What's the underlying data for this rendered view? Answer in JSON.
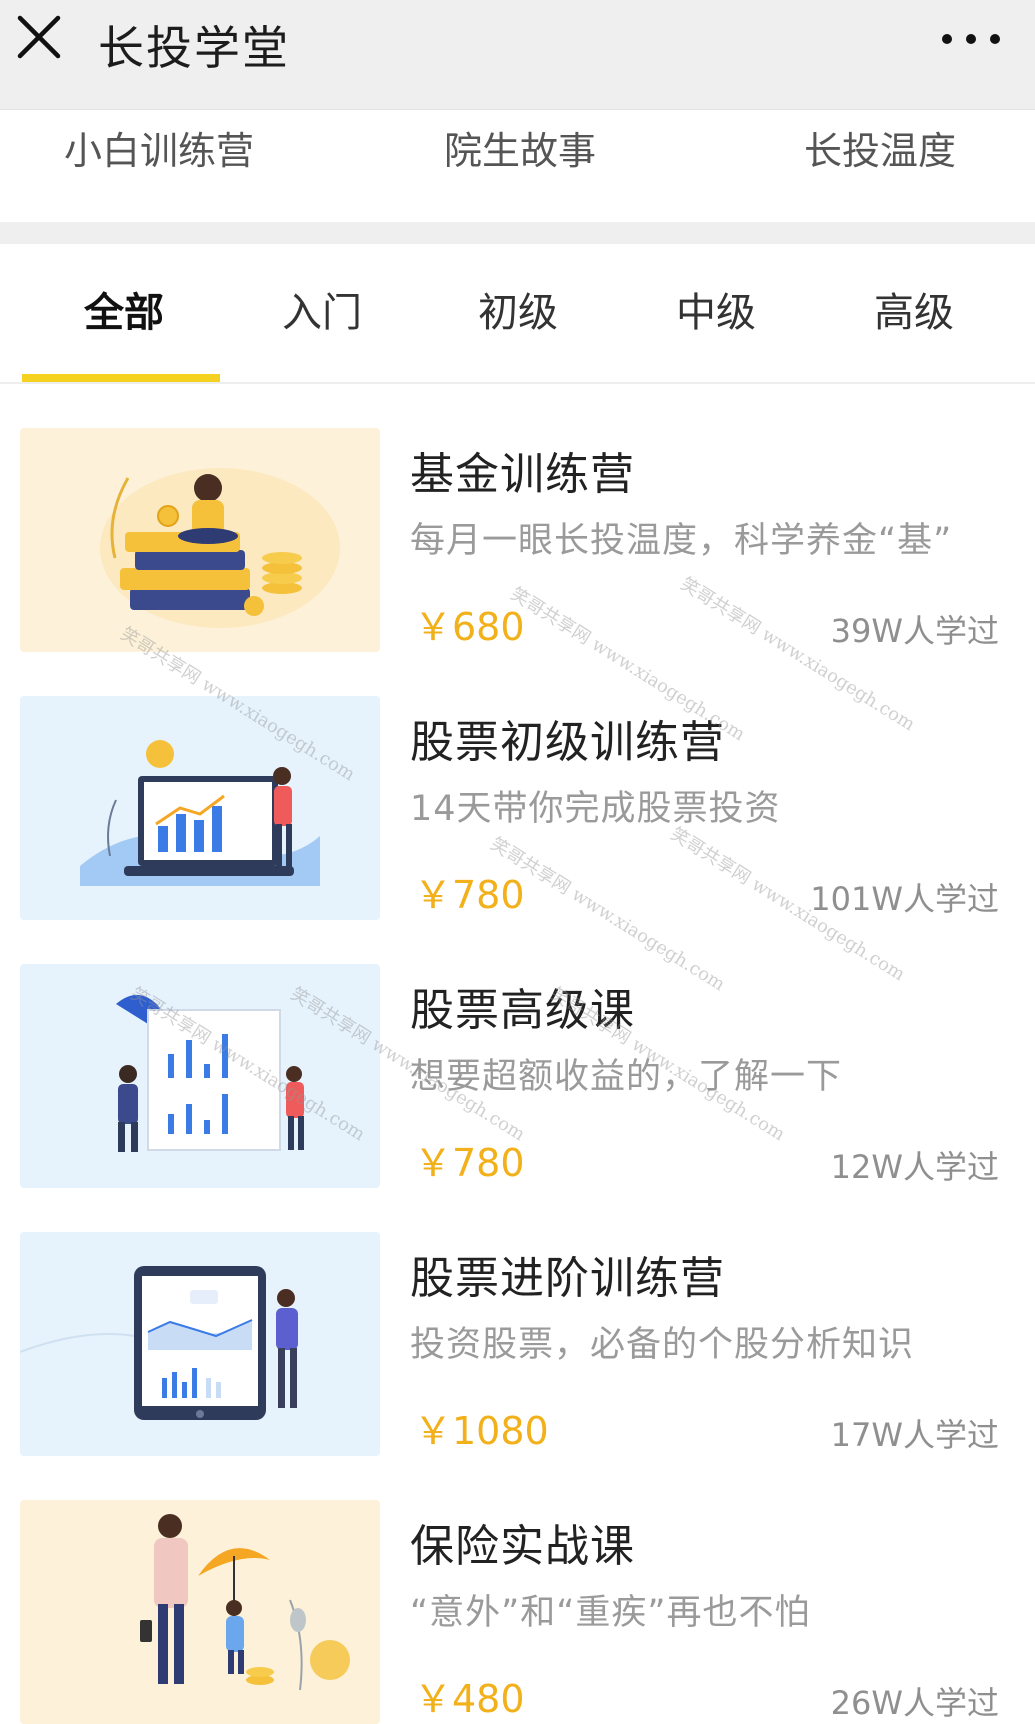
{
  "titlebar": {
    "title": "长投学堂",
    "close_icon": "close-icon",
    "more_icon": "more-dots-icon"
  },
  "topnav": {
    "items": [
      "小白训练营",
      "院生故事",
      "长投温度"
    ]
  },
  "tabs": {
    "items": [
      "全部",
      "入门",
      "初级",
      "中级",
      "高级"
    ],
    "active_index": 0,
    "accent": "#f5d21f"
  },
  "courses": [
    {
      "title": "基金训练营",
      "subtitle": "每月一眼长投温度，科学养金“基”",
      "price": "￥680",
      "learners": "39W人学过",
      "thumb_bg": "#fdf2d9",
      "thumb_icon": "books-coins-illustration"
    },
    {
      "title": "股票初级训练营",
      "subtitle": "14天带你完成股票投资",
      "price": "￥780",
      "learners": "101W人学过",
      "thumb_bg": "#e6f3fd",
      "thumb_icon": "laptop-chart-illustration"
    },
    {
      "title": "股票高级课",
      "subtitle": "想要超额收益的，了解一下",
      "price": "￥780",
      "learners": "12W人学过",
      "thumb_bg": "#e6f3fd",
      "thumb_icon": "whiteboard-chart-illustration"
    },
    {
      "title": "股票进阶训练营",
      "subtitle": "投资股票，必备的个股分析知识",
      "price": "￥1080",
      "learners": "17W人学过",
      "thumb_bg": "#e6f3fd",
      "thumb_icon": "tablet-chart-illustration"
    },
    {
      "title": "保险实战课",
      "subtitle": "“意外”和“重疾”再也不怕",
      "price": "￥480",
      "learners": "26W人学过",
      "thumb_bg": "#fdf2d9",
      "thumb_icon": "umbrella-family-illustration"
    }
  ],
  "colors": {
    "price": "#f2b01b",
    "header_bg": "#efefef"
  },
  "watermark": "笑哥共享网 www.xiaogegh.com"
}
